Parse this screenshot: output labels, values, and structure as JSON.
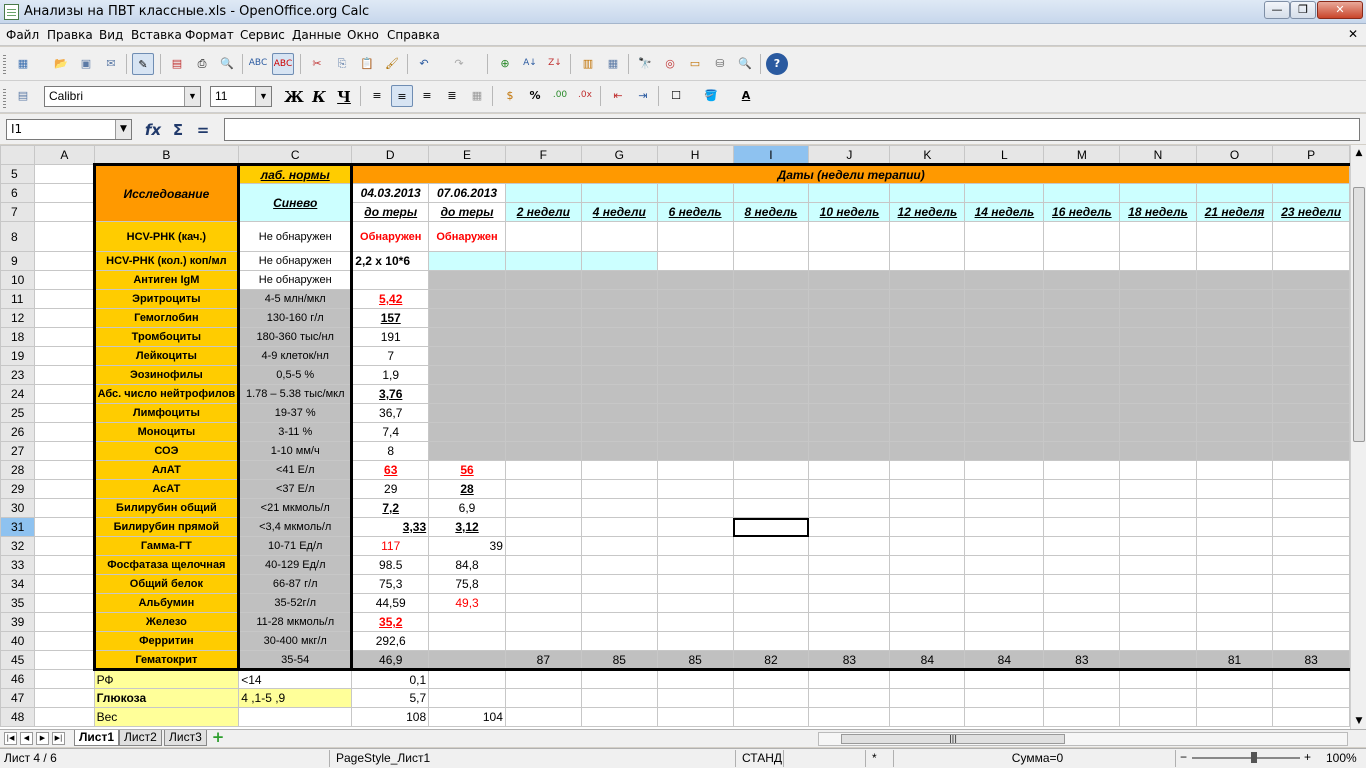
{
  "window": {
    "title": "Анализы на ПВТ классные.xls - OpenOffice.org Calc",
    "min": "—",
    "max": "❐",
    "close": "✕"
  },
  "menu": [
    "Файл",
    "Правка",
    "Вид",
    "Вставка",
    "Формат",
    "Сервис",
    "Данные",
    "Окно",
    "Справка"
  ],
  "menu_close": "✕",
  "format_toolbar": {
    "font_name": "Calibri",
    "font_size": "11",
    "bold": "Ж",
    "italic": "К",
    "underline": "Ч"
  },
  "formula_bar": {
    "name_box": "I1",
    "fx": "fx",
    "sum": "Σ",
    "equals": "=",
    "value": ""
  },
  "grid": {
    "columns": [
      "A",
      "B",
      "C",
      "D",
      "E",
      "F",
      "G",
      "H",
      "I",
      "J",
      "K",
      "L",
      "M",
      "N",
      "O",
      "P"
    ],
    "selected_column": "I",
    "selected_row": "31",
    "header_row5": {
      "B": "Исследование",
      "C": "лаб. нормы",
      "D": "Даты (недели терапии)"
    },
    "row6": {
      "C": "Синево",
      "D": "04.03.2013",
      "E": "07.06.2013"
    },
    "row7": {
      "D": "до теры",
      "E": "до теры",
      "F": "2 недели",
      "G": "4 недели",
      "H": "6 недель",
      "I": "8 недель",
      "J": "10 недель",
      "K": "12 недель",
      "L": "14 недель",
      "M": "16 недель",
      "N": "18 недель",
      "O": "21 неделя",
      "P": "23 недели"
    },
    "rows": [
      {
        "n": "8",
        "b": "HCV-РНК (кач.)",
        "c": "Не обнаружен",
        "d": "Обнаружен",
        "e": "Обнаружен"
      },
      {
        "n": "9",
        "b": "HCV-РНК (кол.) коп/мл",
        "c": "Не обнаружен",
        "d": "2,2 х 10*6",
        "e": ""
      },
      {
        "n": "10",
        "b": "Антиген IgM",
        "c": "Не обнаружен",
        "d": "",
        "e": ""
      },
      {
        "n": "11",
        "b": "Эритроциты",
        "c": "4-5 млн/мкл",
        "d": "5,42",
        "e": ""
      },
      {
        "n": "12",
        "b": "Гемоглобин",
        "c": "130-160 г/л",
        "d": "157",
        "e": ""
      },
      {
        "n": "18",
        "b": "Тромбоциты",
        "c": "180-360 тыс/нл",
        "d": "191",
        "e": ""
      },
      {
        "n": "19",
        "b": "Лейкоциты",
        "c": "4-9 клеток/нл",
        "d": "7",
        "e": ""
      },
      {
        "n": "23",
        "b": "Эозинофилы",
        "c": "0,5-5 %",
        "d": "1,9",
        "e": ""
      },
      {
        "n": "24",
        "b": "Абс. число нейтрофилов",
        "c": "1.78 – 5.38 тыс/мкл",
        "d": "3,76",
        "e": ""
      },
      {
        "n": "25",
        "b": "Лимфоциты",
        "c": "19-37 %",
        "d": "36,7",
        "e": ""
      },
      {
        "n": "26",
        "b": "Моноциты",
        "c": "3-11 %",
        "d": "7,4",
        "e": ""
      },
      {
        "n": "27",
        "b": "СОЭ",
        "c": "1-10 мм/ч",
        "d": "8",
        "e": ""
      },
      {
        "n": "28",
        "b": "АлАТ",
        "c": "<41 Е/л",
        "d": "63",
        "e": "56"
      },
      {
        "n": "29",
        "b": "АсАТ",
        "c": "<37 Е/л",
        "d": "29",
        "e": "28"
      },
      {
        "n": "30",
        "b": "Билирубин общий",
        "c": "<21 мкмоль/л",
        "d": "7,2",
        "e": "6,9"
      },
      {
        "n": "31",
        "b": "Билирубин прямой",
        "c": "<3,4 мкмоль/л",
        "d": "3,33",
        "e": "3,12"
      },
      {
        "n": "32",
        "b": "Гамма-ГТ",
        "c": "10-71 Ед/л",
        "d": "117",
        "e": "39"
      },
      {
        "n": "33",
        "b": "Фосфатаза щелочная",
        "c": "40-129 Ед/л",
        "d": "98.5",
        "e": "84,8"
      },
      {
        "n": "34",
        "b": "Общий белок",
        "c": "66-87 г/л",
        "d": "75,3",
        "e": "75,8"
      },
      {
        "n": "35",
        "b": "Альбумин",
        "c": "35-52г/л",
        "d": "44,59",
        "e": "49,3"
      },
      {
        "n": "39",
        "b": "Железо",
        "c": "11-28 мкмоль/л",
        "d": "35,2",
        "e": ""
      },
      {
        "n": "40",
        "b": "Ферритин",
        "c": "30-400 мкг/л",
        "d": "292,6",
        "e": ""
      },
      {
        "n": "45",
        "b": "Гематокрит",
        "c": "35-54",
        "d": "46,9",
        "e": ""
      }
    ],
    "row45_extra": {
      "F": "87",
      "G": "85",
      "H": "85",
      "I": "82",
      "J": "83",
      "K": "84",
      "L": "84",
      "M": "83",
      "N": "",
      "O": "81",
      "P": "83"
    },
    "row46": {
      "n": "46",
      "b": "РФ",
      "c": "<14",
      "d": "0,1"
    },
    "row47": {
      "n": "47",
      "b": "Глюкоза",
      "c": "4 ,1-5 ,9",
      "d": "5,7"
    },
    "row48": {
      "n": "48",
      "b": "Вес",
      "c": "",
      "d": "108",
      "e": "104"
    },
    "colors": {
      "orange": "#ff9900",
      "label_bg": "#ffcc00",
      "cyan": "#ccffff",
      "gray": "#c0c0c0",
      "yellow": "#ffff99",
      "alert_red": "#ff0000"
    }
  },
  "tabs": {
    "sheets": [
      "Лист1",
      "Лист2",
      "Лист3"
    ],
    "active": "Лист1",
    "add": "+"
  },
  "status": {
    "sheet": "Лист 4 / 6",
    "page_style": "PageStyle_Лист1",
    "mode": "СТАНД",
    "flag": "*",
    "sum": "Сумма=0",
    "zoom": "100%",
    "zoom_minus": "−",
    "zoom_plus": "+"
  }
}
